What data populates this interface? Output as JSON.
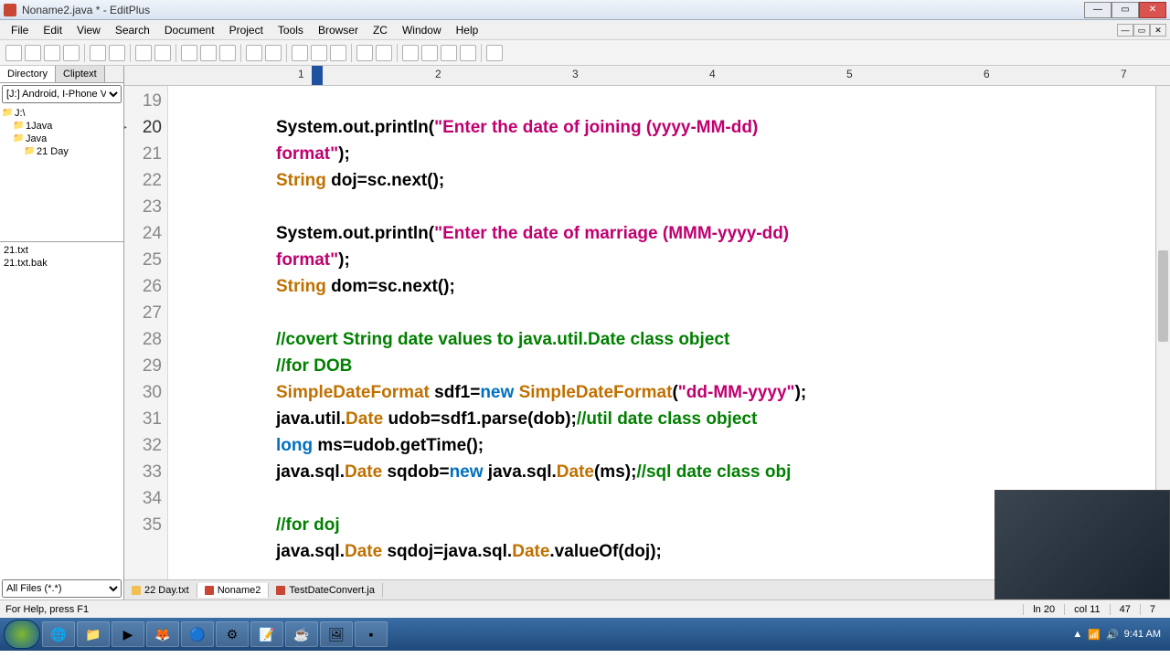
{
  "window": {
    "title": "Noname2.java * - EditPlus"
  },
  "menu": [
    "File",
    "Edit",
    "View",
    "Search",
    "Document",
    "Project",
    "Tools",
    "Browser",
    "ZC",
    "Window",
    "Help"
  ],
  "sidebar": {
    "tabs": [
      "Directory",
      "Cliptext"
    ],
    "drive": "[J:] Android, I-Phone V",
    "tree": [
      {
        "label": "J:\\",
        "indent": 0
      },
      {
        "label": "1Java",
        "indent": 1
      },
      {
        "label": "Java",
        "indent": 1
      },
      {
        "label": "21 Day",
        "indent": 2
      }
    ],
    "files": [
      "21.txt",
      "21.txt.bak"
    ],
    "filter": "All Files (*.*)"
  },
  "ruler": {
    "marks": [
      "1",
      "2",
      "3",
      "4",
      "5",
      "6",
      "7"
    ]
  },
  "code": {
    "lines": [
      {
        "n": "19",
        "html": ""
      },
      {
        "n": "20",
        "active": true,
        "html": "System.out.println(<span class='str'>\"Enter the date of joining (yyyy-MM-dd)</span>"
      },
      {
        "n": "",
        "cont": true,
        "html": "<span class='str'>format\"</span>);"
      },
      {
        "n": "21",
        "html": "<span class='type'>String</span> doj=sc.next();"
      },
      {
        "n": "22",
        "html": ""
      },
      {
        "n": "23",
        "html": "System.out.println(<span class='str'>\"Enter the date of marriage (MMM-yyyy-dd)</span>"
      },
      {
        "n": "",
        "cont": true,
        "html": "<span class='str'>format\"</span>);"
      },
      {
        "n": "24",
        "html": "<span class='type'>String</span> dom=sc.next();"
      },
      {
        "n": "25",
        "html": ""
      },
      {
        "n": "26",
        "html": "<span class='com'>//covert String date values to java.util.Date class object</span>"
      },
      {
        "n": "27",
        "html": "<span class='com'>//for DOB</span>"
      },
      {
        "n": "28",
        "html": "<span class='cls'>SimpleDateFormat</span> sdf1=<span class='kw'>new</span> <span class='cls'>SimpleDateFormat</span>(<span class='str'>\"dd-MM-yyyy\"</span>);"
      },
      {
        "n": "29",
        "html": "java.util.<span class='cls'>Date</span> udob=sdf1.parse(dob);<span class='com'>//util date class object</span>"
      },
      {
        "n": "30",
        "html": "<span class='kw'>long</span> ms=udob.getTime();"
      },
      {
        "n": "31",
        "html": "java.sql.<span class='cls'>Date</span> sqdob=<span class='kw'>new</span> java.sql.<span class='cls'>Date</span>(ms);<span class='com'>//sql date class obj</span>"
      },
      {
        "n": "32",
        "html": ""
      },
      {
        "n": "33",
        "html": "<span class='com'>//for doj</span>"
      },
      {
        "n": "34",
        "html": "java.sql.<span class='cls'>Date</span> sqdoj=java.sql.<span class='cls'>Date</span>.valueOf(doj);"
      },
      {
        "n": "35",
        "html": ""
      }
    ]
  },
  "doctabs": [
    {
      "label": "22 Day.txt",
      "folder": true
    },
    {
      "label": "Noname2",
      "active": true
    },
    {
      "label": "TestDateConvert.ja"
    }
  ],
  "status": {
    "help": "For Help, press F1",
    "ln": "ln 20",
    "col": "col 11",
    "v1": "47",
    "v2": "7"
  },
  "tray": {
    "time": "9:41 AM"
  }
}
